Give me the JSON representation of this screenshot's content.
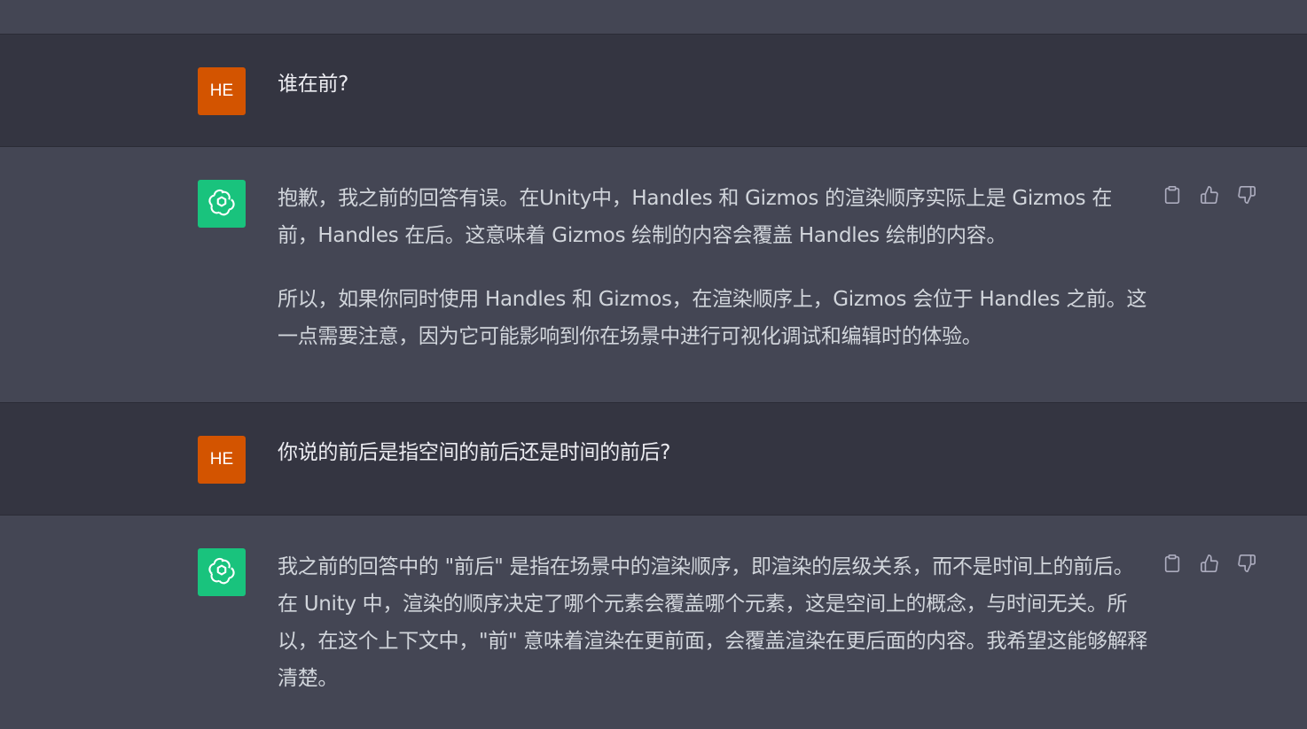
{
  "conversation": {
    "messages": [
      {
        "role": "user",
        "avatar": "HE",
        "text": "谁在前?"
      },
      {
        "role": "assistant",
        "avatar_icon": "openai-logo-icon",
        "paragraphs": [
          "抱歉，我之前的回答有误。在Unity中，Handles 和 Gizmos 的渲染顺序实际上是 Gizmos 在前，Handles 在后。这意味着 Gizmos 绘制的内容会覆盖 Handles 绘制的内容。",
          "所以，如果你同时使用 Handles 和 Gizmos，在渲染顺序上，Gizmos 会位于 Handles 之前。这一点需要注意，因为它可能影响到你在场景中进行可视化调试和编辑时的体验。"
        ]
      },
      {
        "role": "user",
        "avatar": "HE",
        "text": "你说的前后是指空间的前后还是时间的前后?"
      },
      {
        "role": "assistant",
        "avatar_icon": "openai-logo-icon",
        "paragraphs": [
          "我之前的回答中的 \"前后\" 是指在场景中的渲染顺序，即渲染的层级关系，而不是时间上的前后。在 Unity 中，渲染的顺序决定了哪个元素会覆盖哪个元素，这是空间上的概念，与时间无关。所以，在这个上下文中，\"前\" 意味着渲染在更前面，会覆盖渲染在更后面的内容。我希望这能够解释清楚。"
        ]
      }
    ]
  },
  "action_icons": [
    "clipboard-icon",
    "thumbs-up-icon",
    "thumbs-down-icon"
  ],
  "colors": {
    "user_bg": "#343541",
    "assistant_bg": "#444654",
    "user_avatar": "#d35400",
    "gpt_avatar": "#19c37d",
    "text": "#d1d5db"
  }
}
